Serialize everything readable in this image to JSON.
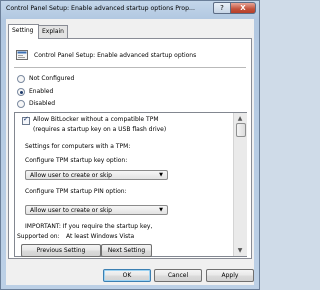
{
  "window": {
    "title": "Control Panel Setup: Enable advanced startup options Prop...",
    "help_label": "?",
    "close_label": "X"
  },
  "tabs": [
    {
      "label": "Setting",
      "active": true
    },
    {
      "label": "Explain",
      "active": false
    }
  ],
  "policy": {
    "icon": "policy-icon",
    "title": "Control Panel Setup: Enable advanced startup options"
  },
  "state_options": [
    {
      "label": "Not Configured",
      "selected": false
    },
    {
      "label": "Enabled",
      "selected": true
    },
    {
      "label": "Disabled",
      "selected": false
    }
  ],
  "options": {
    "allow_bitlocker": {
      "checked": true,
      "line1": "Allow BitLocker without a compatible TPM",
      "line2": "(requires a startup key on a USB flash drive)"
    },
    "settings_heading": "Settings for computers with a TPM:",
    "startup_key_label": "Configure TPM startup key option:",
    "startup_key_value": "Allow user to create or skip",
    "startup_pin_label": "Configure TPM startup PIN option:",
    "startup_pin_value": "Allow user to create or skip",
    "important_line": "IMPORTANT: If you require the startup key,"
  },
  "supported": {
    "label": "Supported on:",
    "value": "At least Windows Vista"
  },
  "buttons": {
    "previous": "Previous Setting",
    "next": "Next Setting",
    "ok": "OK",
    "cancel": "Cancel",
    "apply": "Apply"
  },
  "colors": {
    "titlebar": "#b2c8e1",
    "close_button": "#c2513b",
    "client": "#f0f0f0",
    "default_button_border": "#3c7fb1"
  }
}
